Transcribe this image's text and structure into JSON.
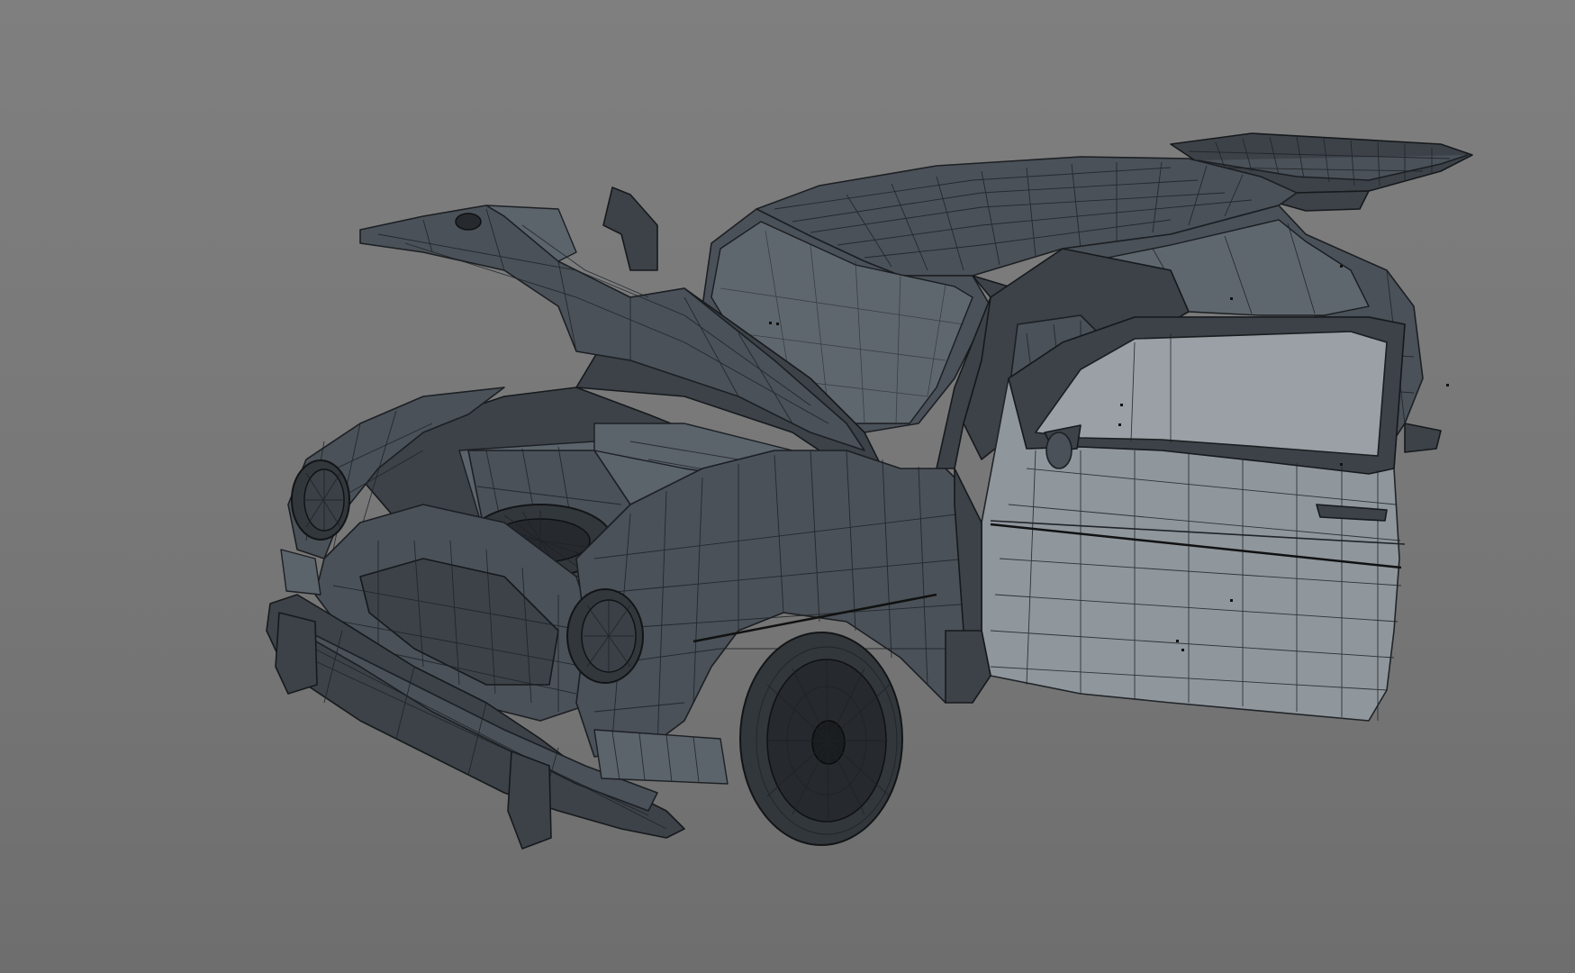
{
  "viewport": {
    "background_top": "#7f7f7f",
    "background_bottom": "#6e6e6e"
  },
  "model": {
    "render_mode": "wireframe-on-shaded",
    "shell_color": "#4a5158",
    "door_color": "#8f969c",
    "wire_color": "#1e2226",
    "parts": [
      "roof",
      "windshield",
      "hood-open",
      "engine-bay",
      "spare-tire",
      "front-fender",
      "headlight-left",
      "headlight-right",
      "front-bumper",
      "front-wheel",
      "driver-door-open",
      "door-mirror",
      "tailgate-open",
      "rear-window"
    ]
  }
}
